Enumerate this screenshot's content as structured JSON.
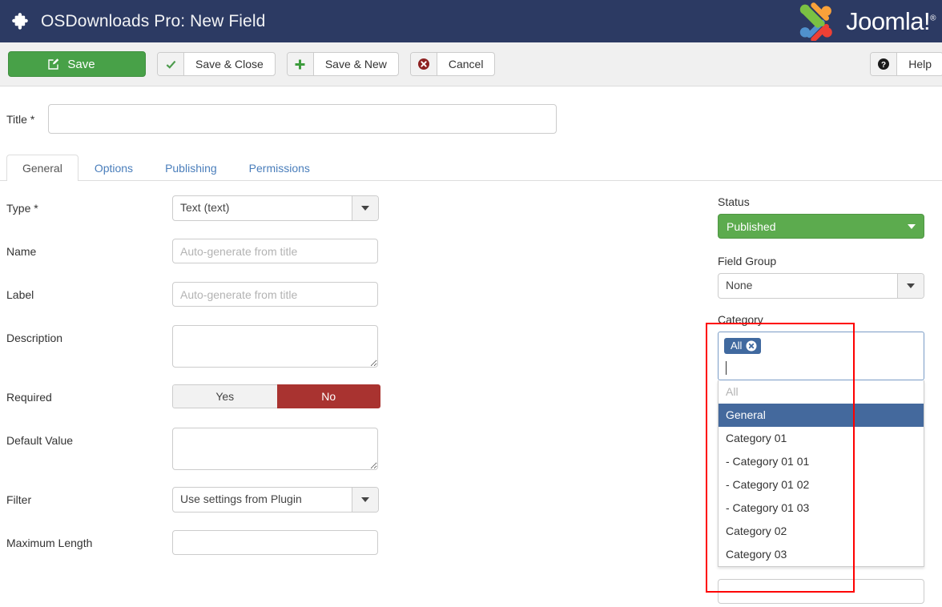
{
  "header": {
    "title": "OSDownloads Pro: New Field",
    "puzzle_icon": "puzzle-piece-icon",
    "brand": "Joomla!",
    "brand_reg": "®"
  },
  "toolbar": {
    "save_label": "Save",
    "save_icon": "pencil-square-icon",
    "save_close_label": "Save & Close",
    "save_close_icon": "check-icon",
    "save_new_label": "Save & New",
    "save_new_icon": "plus-icon",
    "cancel_label": "Cancel",
    "cancel_icon": "times-circle-icon",
    "help_label": "Help",
    "help_icon": "question-circle-icon"
  },
  "title_field": {
    "label": "Title *",
    "value": "",
    "placeholder": ""
  },
  "tabs": [
    {
      "label": "General",
      "active": true
    },
    {
      "label": "Options",
      "active": false
    },
    {
      "label": "Publishing",
      "active": false
    },
    {
      "label": "Permissions",
      "active": false
    }
  ],
  "form": {
    "type": {
      "label": "Type *",
      "value": "Text (text)"
    },
    "name": {
      "label": "Name",
      "value": "",
      "placeholder": "Auto-generate from title"
    },
    "field_label": {
      "label": "Label",
      "value": "",
      "placeholder": "Auto-generate from title"
    },
    "description": {
      "label": "Description",
      "value": ""
    },
    "required": {
      "label": "Required",
      "yes_label": "Yes",
      "no_label": "No",
      "selected": "No"
    },
    "default_value": {
      "label": "Default Value",
      "value": ""
    },
    "filter": {
      "label": "Filter",
      "value": "Use settings from Plugin"
    },
    "maximum_length": {
      "label": "Maximum Length",
      "value": ""
    }
  },
  "sidebar": {
    "status": {
      "label": "Status",
      "value": "Published"
    },
    "field_group": {
      "label": "Field Group",
      "value": "None"
    },
    "category": {
      "label": "Category",
      "selected_chips": [
        {
          "label": "All",
          "remove_icon": "close-circle-icon"
        }
      ],
      "input_value": "",
      "options": [
        {
          "label": "All",
          "state": "disabled"
        },
        {
          "label": "General",
          "state": "highlight"
        },
        {
          "label": "Category 01",
          "state": "normal"
        },
        {
          "label": "- Category 01 01",
          "state": "normal"
        },
        {
          "label": "- Category 01 02",
          "state": "normal"
        },
        {
          "label": "- Category 01 03",
          "state": "normal"
        },
        {
          "label": "Category 02",
          "state": "normal"
        },
        {
          "label": "Category 03",
          "state": "normal"
        }
      ]
    }
  },
  "colors": {
    "header_bg": "#2c3a63",
    "save_green": "#48a148",
    "status_green": "#5cab4e",
    "toggle_red": "#a93330",
    "chip_blue": "#40699f",
    "highlight_blue": "#44699d",
    "annotation_red": "#fe0000",
    "tab_link_blue": "#4a7ebb"
  }
}
